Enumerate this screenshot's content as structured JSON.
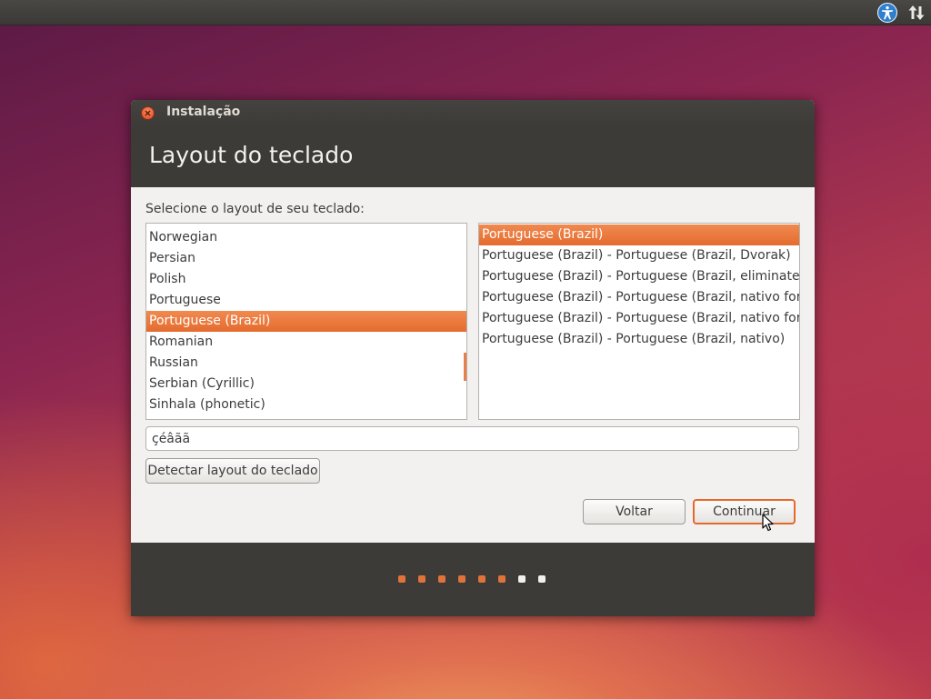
{
  "panel": {
    "icons": [
      "accessibility-icon",
      "network-updown-icon"
    ]
  },
  "window": {
    "title": "Instalação",
    "page_title": "Layout do teclado"
  },
  "instruction": "Selecione o layout de seu teclado:",
  "layouts": [
    {
      "label": "Norwegian",
      "selected": false
    },
    {
      "label": "Persian",
      "selected": false
    },
    {
      "label": "Polish",
      "selected": false
    },
    {
      "label": "Portuguese",
      "selected": false
    },
    {
      "label": "Portuguese (Brazil)",
      "selected": true
    },
    {
      "label": "Romanian",
      "selected": false
    },
    {
      "label": "Russian",
      "selected": false
    },
    {
      "label": "Serbian (Cyrillic)",
      "selected": false
    },
    {
      "label": "Sinhala (phonetic)",
      "selected": false
    }
  ],
  "variants": [
    {
      "label": "Portuguese (Brazil)",
      "selected": true
    },
    {
      "label": "Portuguese (Brazil) - Portuguese (Brazil, Dvorak)",
      "selected": false
    },
    {
      "label": "Portuguese (Brazil) - Portuguese (Brazil, eliminate de",
      "selected": false
    },
    {
      "label": "Portuguese (Brazil) - Portuguese (Brazil, nativo for Es",
      "selected": false
    },
    {
      "label": "Portuguese (Brazil) - Portuguese (Brazil, nativo for US",
      "selected": false
    },
    {
      "label": "Portuguese (Brazil) - Portuguese (Brazil, nativo)",
      "selected": false
    }
  ],
  "test_field": {
    "value": "çéâãã",
    "placeholder": ""
  },
  "buttons": {
    "detect": "Detectar layout do teclado",
    "back": "Voltar",
    "continue": "Continuar"
  },
  "progress": {
    "total_steps": 8,
    "completed_steps": 6
  },
  "colors": {
    "accent": "#e56b2e",
    "dot_done": "#e0733a",
    "dot_pending": "#f2f1f0",
    "titlebar": "#3c3b37"
  }
}
